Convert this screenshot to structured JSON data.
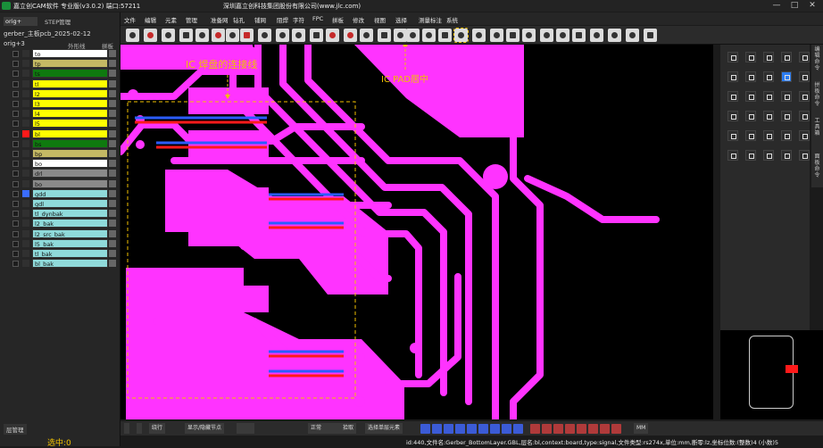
{
  "app": {
    "title": "嘉立创CAM软件 专业版(v3.0.2) 端口:57211",
    "company": "深圳嘉立创科技集团股份有限公司(www.jlc.com)"
  },
  "menu": [
    "文件",
    "编辑",
    "元素",
    "管理",
    "准备网",
    "钻孔",
    "铺网",
    "阻焊",
    "字符",
    "FPC",
    "拼板",
    "修改",
    "视图",
    "选择",
    "测量标注",
    "系统"
  ],
  "left": {
    "tab_orig": "orig+",
    "tab_step": "STEP管理",
    "job_name": "gerber_主板pcb_2025-02-12",
    "step_name": "orig+3",
    "outer_line": "外形线",
    "panel": "拼板",
    "layers": [
      {
        "name": "to",
        "color": "#ffffff"
      },
      {
        "name": "tp",
        "color": "#c4b964"
      },
      {
        "name": "ts",
        "color": "#0f7a0f"
      },
      {
        "name": "tl",
        "color": "#ffff00"
      },
      {
        "name": "l2",
        "color": "#ffff00"
      },
      {
        "name": "l3",
        "color": "#ffff00"
      },
      {
        "name": "l4",
        "color": "#ffff00"
      },
      {
        "name": "l5",
        "color": "#ffff00"
      },
      {
        "name": "bl",
        "color": "#ffff00"
      },
      {
        "name": "bs",
        "color": "#0f7a0f"
      },
      {
        "name": "bp",
        "color": "#c4b964"
      },
      {
        "name": "bo",
        "color": "#ffffff"
      },
      {
        "name": "drl",
        "color": "#8a8a8a"
      },
      {
        "name": "bo",
        "color": "#8a8a8a"
      },
      {
        "name": "gdd",
        "color": "#8fdada"
      },
      {
        "name": "gdl",
        "color": "#8fdada"
      },
      {
        "name": "tl_dynbak",
        "color": "#8fdada"
      },
      {
        "name": "l2_bak",
        "color": "#8fdada"
      },
      {
        "name": "l2_src_bak",
        "color": "#8fdada"
      },
      {
        "name": "l5_bak",
        "color": "#8fdada"
      },
      {
        "name": "tl_bak",
        "color": "#8fdada"
      },
      {
        "name": "bl_bak",
        "color": "#8fdada"
      }
    ],
    "layer_mgmt": "层管理",
    "selected": "选中:0"
  },
  "annotations": {
    "pad_connect": "IC 焊盘的连接线",
    "pad_center": "IC PAD居中"
  },
  "right_tabs": [
    "编辑命令",
    "拼板命令",
    "工具箱",
    "面板命令"
  ],
  "bottom": {
    "mode": "绕行",
    "show_tree": "显示/隐藏节点",
    "normal": "正常",
    "pick": "拾取",
    "select_all": "选择单层元素",
    "unit": "MM"
  },
  "status": "id:440,文件名:Gerber_BottomLayer.GBL,层名:bl,context:board,type:signal,文件类型:rs274x,单位:mm,断零:lz,坐标位数:(整数)4 (小数)5",
  "colors": {
    "copper": "#ff33ff",
    "accent": "#f0c000",
    "trace_red": "#ff1a1a",
    "trace_blue": "#2a5cff"
  }
}
